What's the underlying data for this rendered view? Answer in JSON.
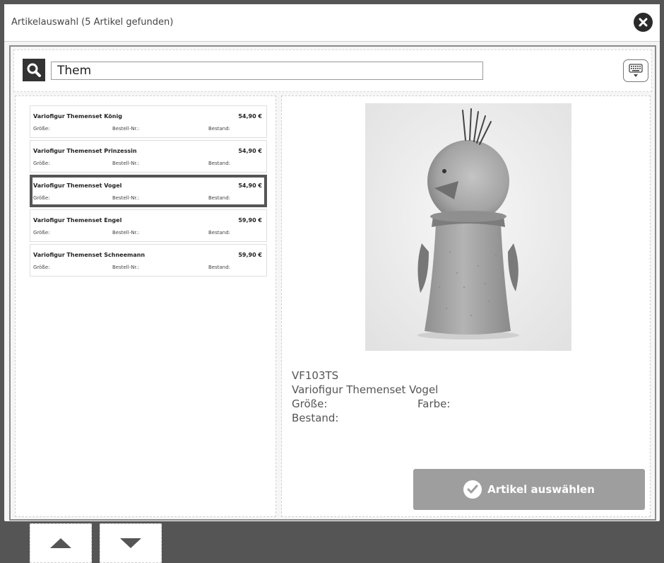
{
  "dialog": {
    "title": "Artikelauswahl (5 Artikel gefunden)"
  },
  "search": {
    "value": "Them",
    "icon": "search-icon",
    "keyboard_icon": "keyboard-icon"
  },
  "list": {
    "labels": {
      "size": "Größe:",
      "order_no": "Bestell-Nr.:",
      "stock": "Bestand:"
    },
    "items": [
      {
        "name": "Variofigur Themenset König",
        "price": "54,90 €"
      },
      {
        "name": "Variofigur Themenset Prinzessin",
        "price": "54,90 €"
      },
      {
        "name": "Variofigur Themenset Vogel",
        "price": "54,90 €"
      },
      {
        "name": "Variofigur Themenset Engel",
        "price": "59,90 €"
      },
      {
        "name": "Variofigur Themenset Schneemann",
        "price": "59,90 €"
      }
    ],
    "selected_index": 2
  },
  "detail": {
    "sku": "VF103TS",
    "name": "Variofigur Themenset Vogel",
    "size_label": "Größe:",
    "color_label": "Farbe:",
    "stock_label": "Bestand:"
  },
  "actions": {
    "select_label": "Artikel auswählen"
  },
  "colors": {
    "frame": "#555555",
    "button": "#9e9e9e",
    "selected_border": "#555555"
  }
}
